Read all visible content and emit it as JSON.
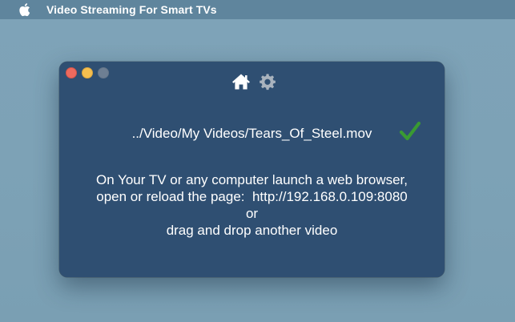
{
  "menubar": {
    "apple_icon": "apple-logo-icon",
    "app_title": "Video Streaming For Smart TVs"
  },
  "window": {
    "toolbar": {
      "home_icon": "home-icon",
      "settings_icon": "gear-icon"
    },
    "file_path": "../Video/My Videos/Tears_Of_Steel.mov",
    "status_icon": "checkmark-icon",
    "instructions": {
      "line1": "On Your TV or any computer launch a web browser,",
      "line2_prefix": "open or reload the page:",
      "url": "http://192.168.0.109:8080",
      "line3": "or",
      "line4": "drag and drop another video"
    }
  },
  "colors": {
    "desktop": "#7ea3b8",
    "window_bg": "#2f4f72",
    "check_green": "#3a9a32",
    "icon_white": "#ffffff",
    "icon_gray": "#a9b3be"
  }
}
